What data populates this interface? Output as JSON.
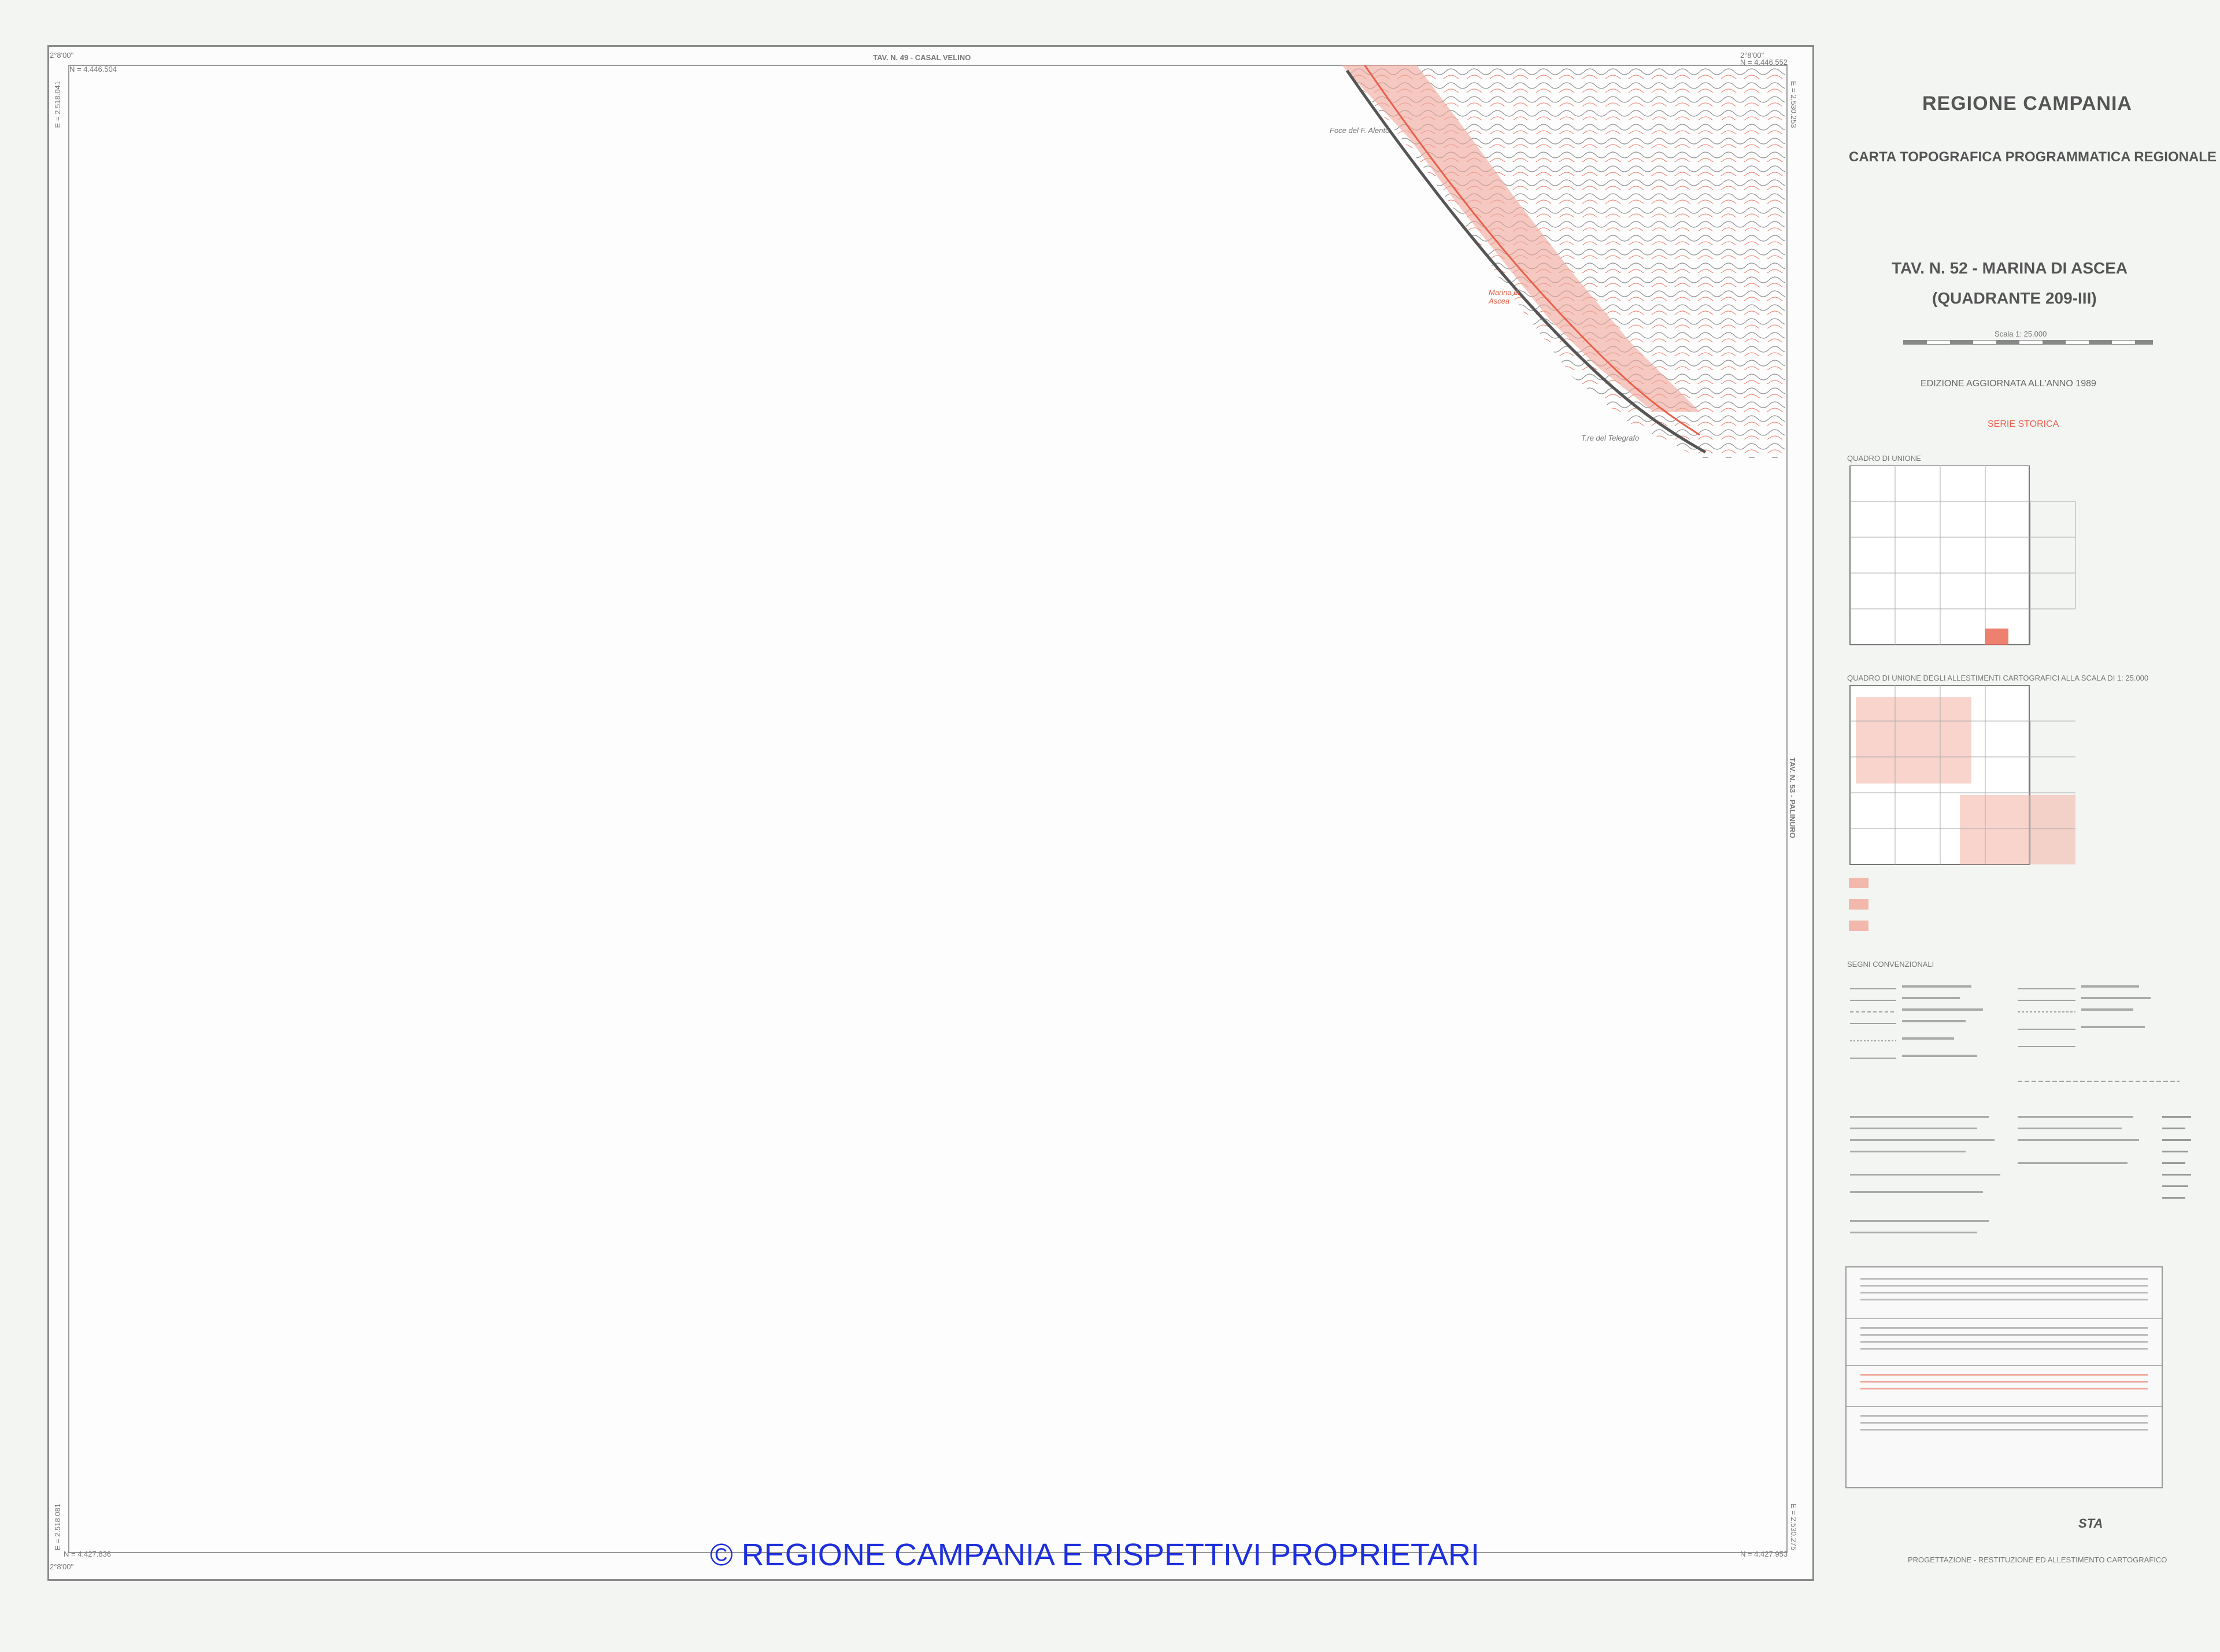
{
  "map": {
    "top_neighbor": "TAV. N. 49 - CASAL VELINO",
    "right_neighbor": "TAV. N. 53 - PALINURO",
    "corner_tl": "2°8'00\"",
    "corner_tl_n": "N = 4.446.504",
    "corner_tl_e": "E = 2.518.041",
    "corner_tr": "2°8'00\"",
    "corner_tr_n": "N = 4.446.552",
    "corner_tr_e": "E = 2.530.253",
    "corner_bl": "2°8'00\"",
    "corner_bl_n": "N = 4.427.836",
    "corner_bl_e": "E = 2.518.081",
    "corner_br_n": "N = 4.427.953",
    "corner_br_e": "E = 2.530.275",
    "place_1": "Foce del F. Alento",
    "place_2": "Marina di Ascea",
    "place_3": "T.re del Telegrafo"
  },
  "sidebar": {
    "region": "REGIONE CAMPANIA",
    "program": "CARTA TOPOGRAFICA PROGRAMMATICA REGIONALE",
    "sheet": "TAV. N. 52 - MARINA DI ASCEA",
    "quadrant": "(QUADRANTE 209-III)",
    "scale": "Scala  1: 25.000",
    "edition": "EDIZIONE AGGIORNATA ALL'ANNO 1989",
    "series": "SERIE STORICA",
    "index_title": "QUADRO DI UNIONE",
    "index2_title": "QUADRO DI UNIONE DEGLI ALLESTIMENTI CARTOGRAFICI ALLA SCALA DI 1: 25.000",
    "legend_title": "SEGNI CONVENZIONALI",
    "footer_company": "STA",
    "footer_line": "PROGETTAZIONE - RESTITUZIONE ED ALLESTIMENTO CARTOGRAFICO"
  },
  "copyright": "© REGIONE CAMPANIA E RISPETTIVI PROPRIETARI",
  "colors": {
    "terrain_red": "#e9604b",
    "copyright_blue": "#1d2fdc"
  }
}
